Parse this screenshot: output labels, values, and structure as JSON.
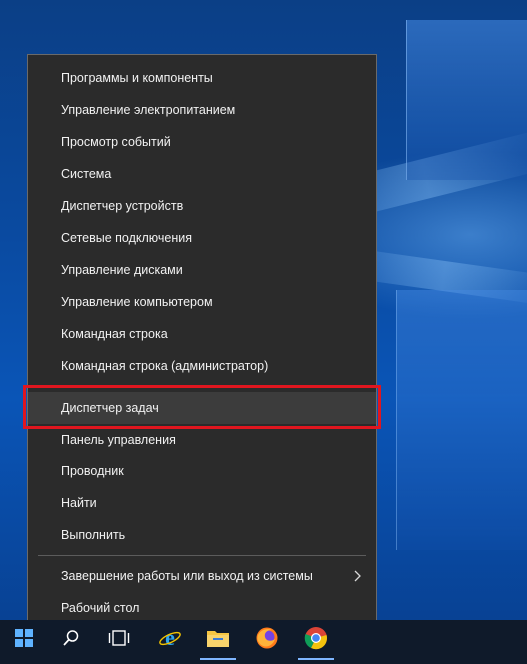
{
  "menu": {
    "items": [
      {
        "label": "Программы и компоненты"
      },
      {
        "label": "Управление электропитанием"
      },
      {
        "label": "Просмотр событий"
      },
      {
        "label": "Система"
      },
      {
        "label": "Диспетчер устройств"
      },
      {
        "label": "Сетевые подключения"
      },
      {
        "label": "Управление дисками"
      },
      {
        "label": "Управление компьютером"
      },
      {
        "label": "Командная строка"
      },
      {
        "label": "Командная строка (администратор)"
      },
      {
        "label": "Диспетчер задач",
        "highlighted": true
      },
      {
        "label": "Панель управления"
      },
      {
        "label": "Проводник"
      },
      {
        "label": "Найти"
      },
      {
        "label": "Выполнить"
      },
      {
        "label": "Завершение работы или выход из системы",
        "submenu": true
      },
      {
        "label": "Рабочий стол"
      }
    ],
    "highlight_color": "#e0161f"
  },
  "taskbar": {
    "buttons": [
      {
        "icon": "windows-start-icon"
      },
      {
        "icon": "search-icon"
      },
      {
        "icon": "task-view-icon"
      },
      {
        "icon": "internet-explorer-icon"
      },
      {
        "icon": "file-explorer-icon"
      },
      {
        "icon": "firefox-icon"
      },
      {
        "icon": "chrome-icon"
      }
    ]
  }
}
